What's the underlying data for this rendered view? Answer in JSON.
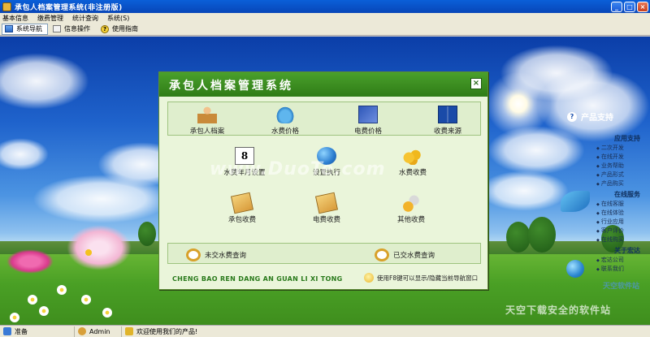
{
  "window": {
    "title": "承包人档案管理系统(非注册版)",
    "controls": {
      "minimize": "_",
      "maximize": "□",
      "close": "×"
    }
  },
  "menubar": [
    "基本信息",
    "缴费管理",
    "统计查询",
    "系统(S)"
  ],
  "toolbar": [
    {
      "label": "系统导航",
      "icon": "nav-icon",
      "active": true
    },
    {
      "label": "信息操作",
      "icon": "info-icon",
      "active": false
    },
    {
      "label": "使用指南",
      "icon": "help-icon",
      "active": false
    }
  ],
  "dialog": {
    "title": "承包人档案管理系统",
    "close_glyph": "×",
    "top_row": [
      {
        "label": "承包人档案",
        "icon": "person-icon"
      },
      {
        "label": "水费价格",
        "icon": "water-drop-icon"
      },
      {
        "label": "电费价格",
        "icon": "electricity-icon"
      },
      {
        "label": "收费来源",
        "icon": "book-icon"
      }
    ],
    "middle_row1": [
      {
        "label": "水费年月设置",
        "icon": "calendar-icon",
        "icon_text": "8"
      },
      {
        "label": "设置执行",
        "icon": "globe-icon"
      },
      {
        "label": "水费收费",
        "icon": "coins-icon"
      }
    ],
    "middle_row2": [
      {
        "label": "承包收费",
        "icon": "cash-icon"
      },
      {
        "label": "电费收费",
        "icon": "cash-icon"
      },
      {
        "label": "其他收费",
        "icon": "misc-icon"
      }
    ],
    "queries": [
      {
        "label": "未交水费查询",
        "icon": "magnifier-icon"
      },
      {
        "label": "已交水费查询",
        "icon": "magnifier-icon"
      }
    ],
    "footer_en": "CHENG BAO REN DANG AN GUAN LI XI TONG",
    "footer_hint": "使用F8键可以显示/隐藏当前导航窗口"
  },
  "side_panel": {
    "title": "产品支持",
    "sections": [
      {
        "name": "应用支持",
        "items": [
          "二次开发",
          "在线开发",
          "业务帮助",
          "产品形式",
          "产品购买"
        ]
      },
      {
        "name": "在线服务",
        "items": [
          "在线客服",
          "在线体验",
          "行业应用",
          "客户评价",
          "在线购买"
        ]
      },
      {
        "name": "关于宏达",
        "items": [
          "宏达公司",
          "联系我们"
        ]
      }
    ]
  },
  "watermark": {
    "main": "www.DuoTe.com",
    "bottom": "天空下载安全的软件站",
    "logo_text": "天空软件站"
  },
  "statusbar": {
    "ready": "准备",
    "user": "Admin",
    "welcome": "欢迎使用我们的产品!"
  }
}
